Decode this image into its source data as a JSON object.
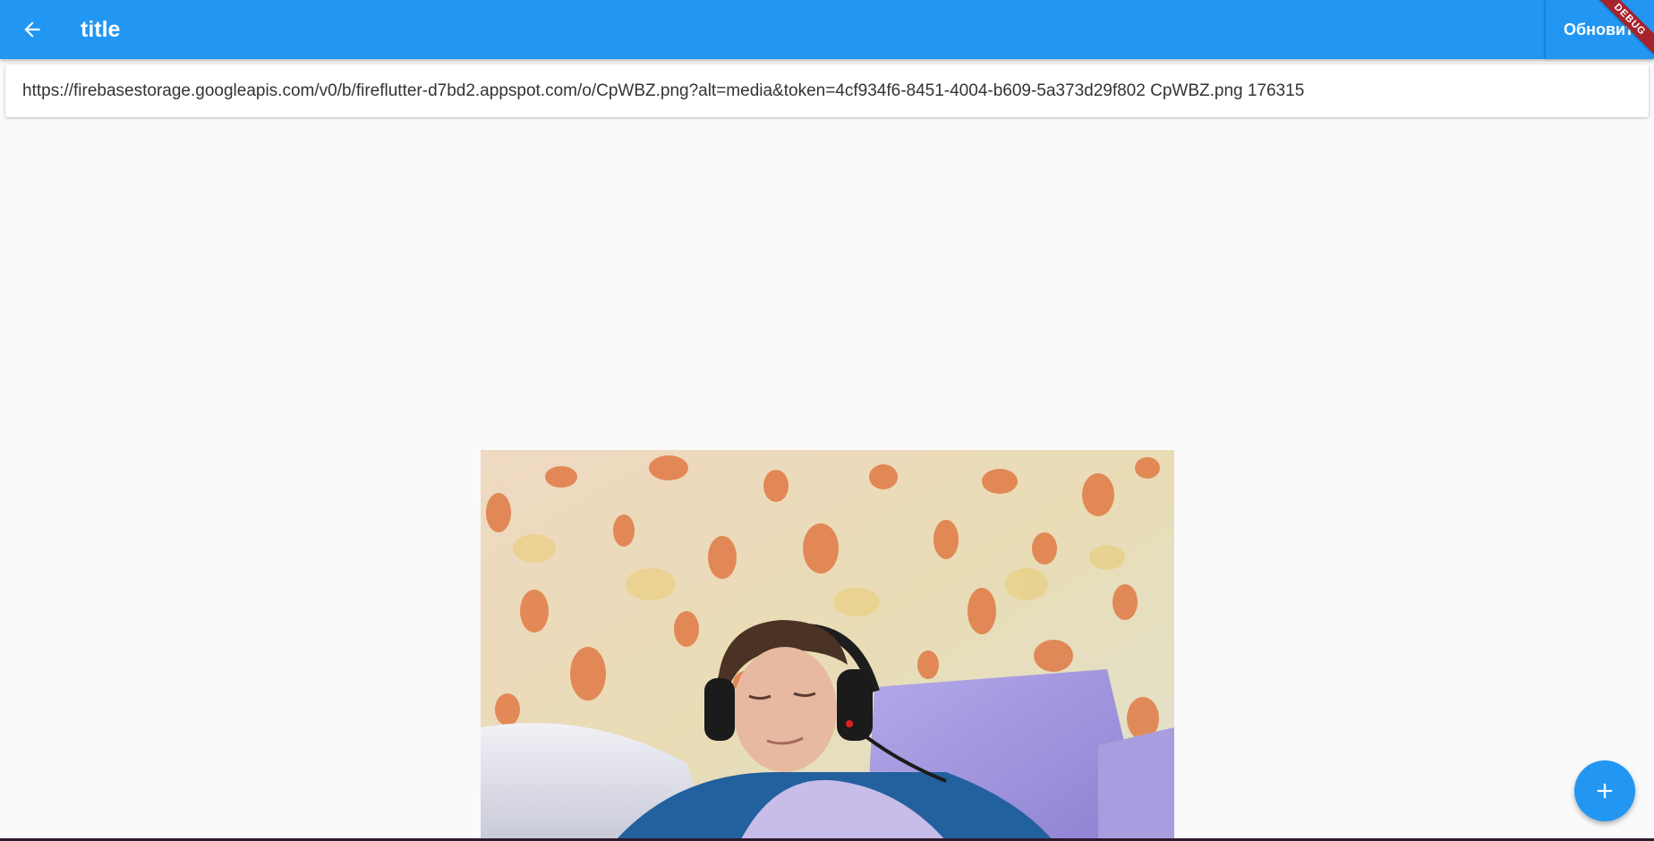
{
  "appbar": {
    "title": "title",
    "back_icon": "arrow-back-icon",
    "update_label": "Обновить",
    "color": "#2196f3"
  },
  "debug_banner": "DEBUG",
  "file": {
    "info": "https://firebasestorage.googleapis.com/v0/b/fireflutter-d7bd2.appspot.com/o/CpWBZ.png?alt=media&token=4cf934f6-8451-4004-b609-5a373d29f802 CpWBZ.png 176315"
  },
  "fab": {
    "icon": "add-icon",
    "color": "#2196f3"
  }
}
